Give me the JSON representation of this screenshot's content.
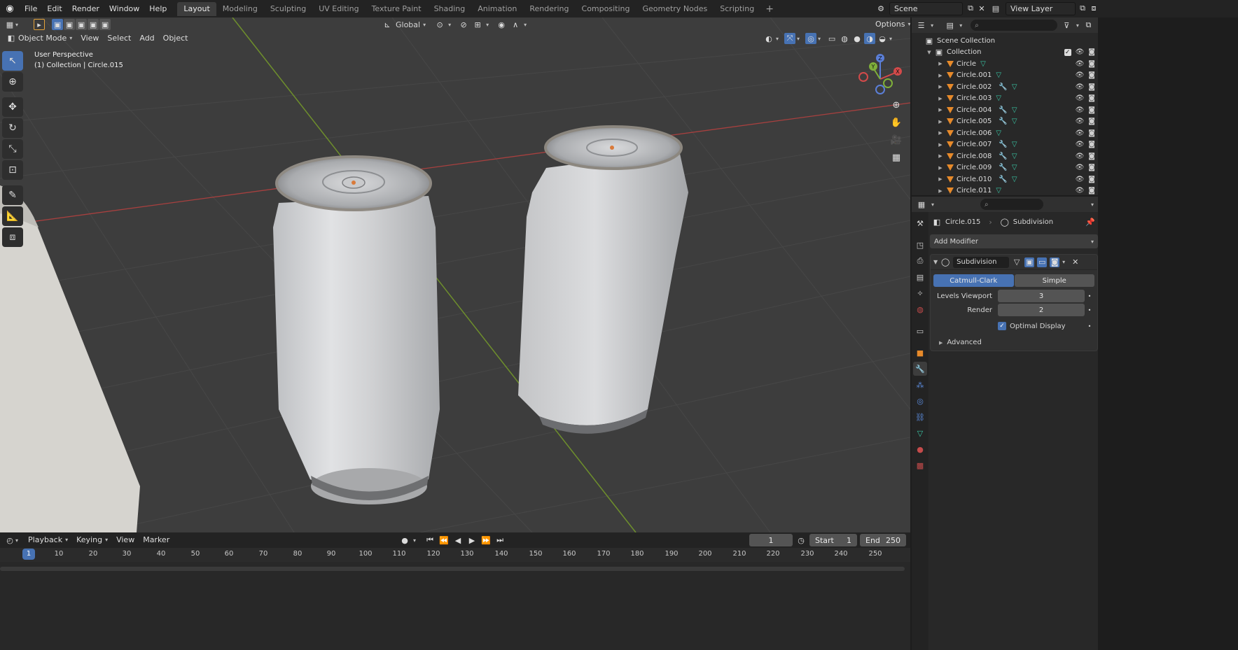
{
  "menubar": {
    "items": [
      "File",
      "Edit",
      "Render",
      "Window",
      "Help"
    ],
    "workspaces": [
      "Layout",
      "Modeling",
      "Sculpting",
      "UV Editing",
      "Texture Paint",
      "Shading",
      "Animation",
      "Rendering",
      "Compositing",
      "Geometry Nodes",
      "Scripting"
    ],
    "add_label": "+",
    "scene": "Scene",
    "view_layer": "View Layer"
  },
  "viewport": {
    "mode": "Object Mode",
    "menus": [
      "View",
      "Select",
      "Add",
      "Object"
    ],
    "transform_orientation": "Global",
    "options_label": "Options",
    "info_line1": "User Perspective",
    "info_line2": "(1) Collection | Circle.015",
    "gizmo": {
      "x": "X",
      "y": "Y",
      "z": "Z"
    }
  },
  "timeline": {
    "menus": [
      "Playback",
      "Keying",
      "View",
      "Marker"
    ],
    "current_frame": "1",
    "start_label": "Start",
    "start_value": "1",
    "end_label": "End",
    "end_value": "250",
    "ruler": [
      "10",
      "20",
      "30",
      "40",
      "50",
      "60",
      "70",
      "80",
      "90",
      "100",
      "110",
      "120",
      "130",
      "140",
      "150",
      "160",
      "170",
      "180",
      "190",
      "200",
      "210",
      "220",
      "230",
      "240",
      "250"
    ],
    "ruler_current": "1"
  },
  "outliner": {
    "scene_collection": "Scene Collection",
    "collection": "Collection",
    "objects": [
      {
        "name": "Circle",
        "modifier": false
      },
      {
        "name": "Circle.001",
        "modifier": false
      },
      {
        "name": "Circle.002",
        "modifier": true
      },
      {
        "name": "Circle.003",
        "modifier": false
      },
      {
        "name": "Circle.004",
        "modifier": true
      },
      {
        "name": "Circle.005",
        "modifier": true
      },
      {
        "name": "Circle.006",
        "modifier": false
      },
      {
        "name": "Circle.007",
        "modifier": true
      },
      {
        "name": "Circle.008",
        "modifier": true
      },
      {
        "name": "Circle.009",
        "modifier": true
      },
      {
        "name": "Circle.010",
        "modifier": true
      },
      {
        "name": "Circle.011",
        "modifier": false
      }
    ]
  },
  "properties": {
    "object_name": "Circle.015",
    "modifier_context": "Subdivision",
    "add_modifier": "Add Modifier",
    "modifier": {
      "name": "Subdivision",
      "type_catmull": "Catmull-Clark",
      "type_simple": "Simple",
      "levels_viewport_label": "Levels Viewport",
      "levels_viewport_value": "3",
      "render_label": "Render",
      "render_value": "2",
      "optimal_display_label": "Optimal Display",
      "advanced_label": "Advanced"
    }
  },
  "colors": {
    "accent": "#4772b3",
    "object_orange": "#e78a2a",
    "axis_red": "#c44b4b",
    "axis_green": "#7fa52f",
    "viewport_bg": "#3d3d3d"
  }
}
